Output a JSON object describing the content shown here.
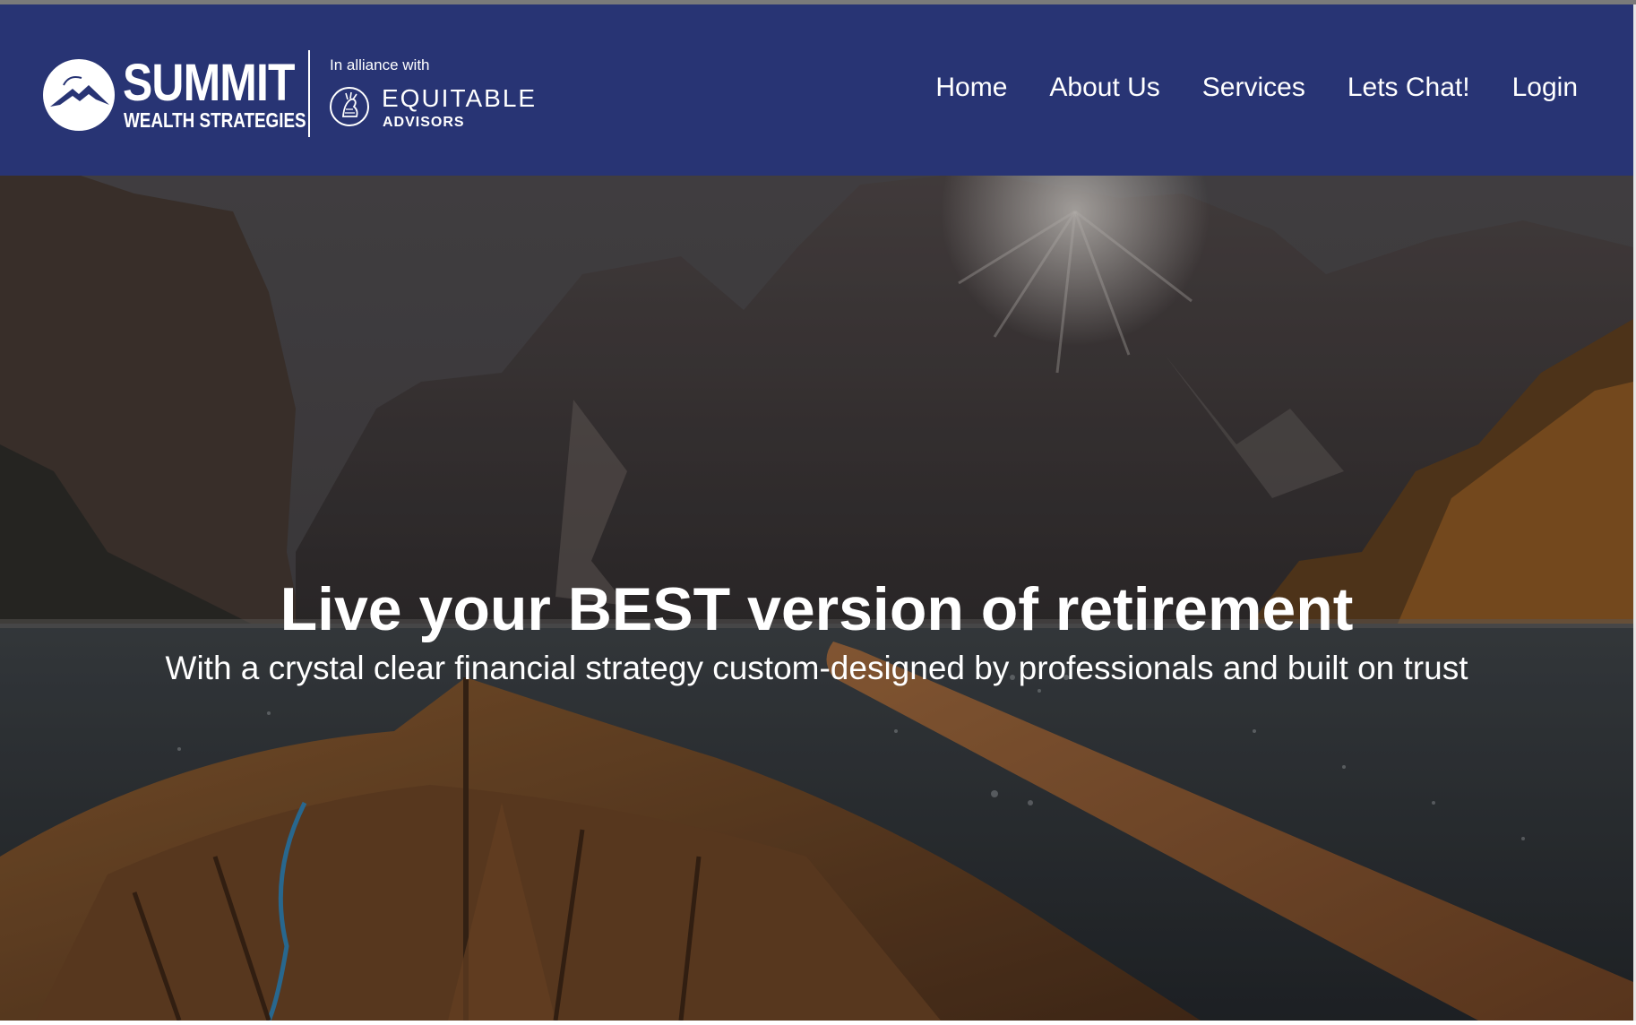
{
  "brand": {
    "summit_name": "SUMMIT",
    "summit_tagline": "WEALTH STRATEGIES",
    "alliance_label": "In alliance with",
    "partner_name": "EQUITABLE",
    "partner_sub": "ADVISORS",
    "colors": {
      "navbar_bg": "#283474",
      "text": "#ffffff"
    }
  },
  "nav": {
    "items": [
      {
        "label": "Home"
      },
      {
        "label": "About Us"
      },
      {
        "label": "Services"
      },
      {
        "label": "Lets Chat!"
      },
      {
        "label": "Login"
      }
    ]
  },
  "hero": {
    "title": "Live your BEST version of retirement",
    "subtitle": "With a crystal clear financial strategy custom-designed by professionals and built on trust",
    "background_image": "mountain-lake-rowboat-photo"
  },
  "icons": {
    "summit_logo": "mountain-peak-icon",
    "equitable_logo": "lady-liberty-icon"
  }
}
